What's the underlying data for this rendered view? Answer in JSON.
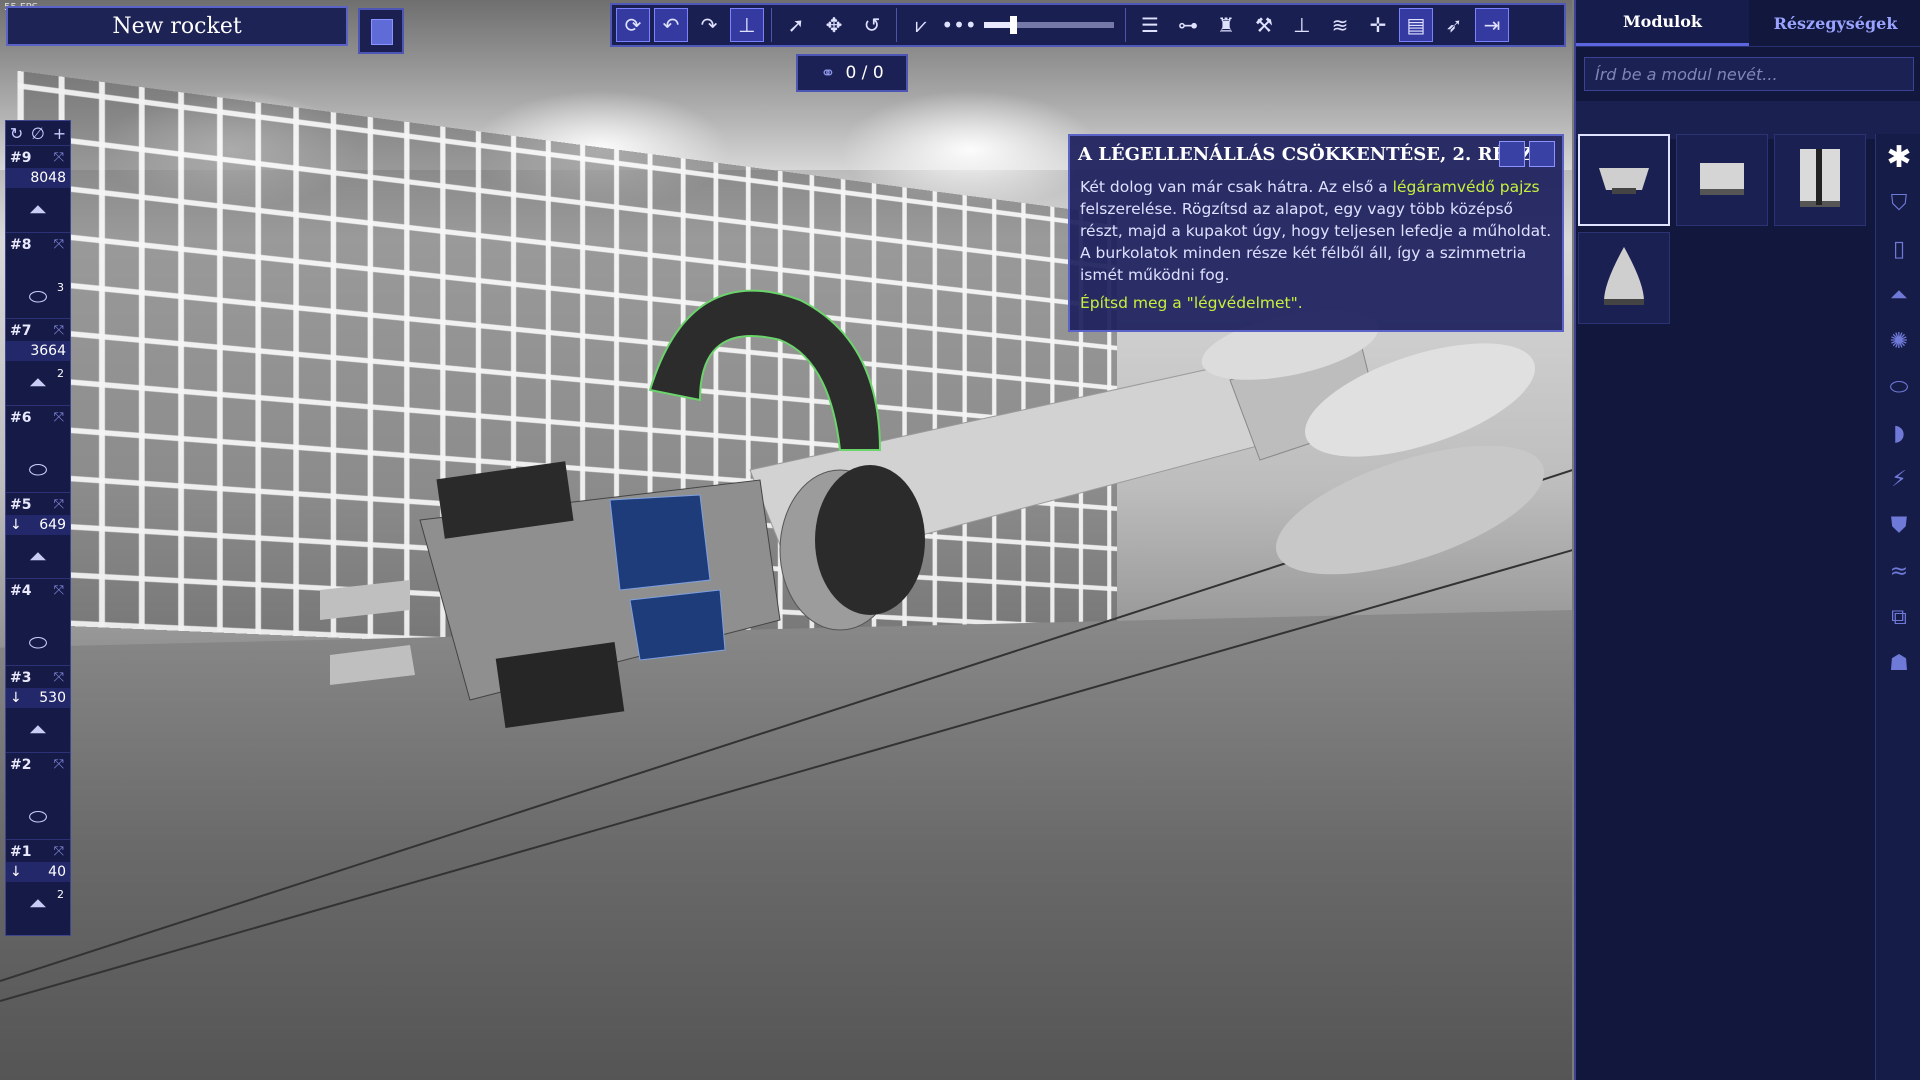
{
  "fps": "55 FPS",
  "rocket_name": "New rocket",
  "counter": {
    "current": "0",
    "sep": "/",
    "total": "0"
  },
  "stages": [
    {
      "num": "#9",
      "value": "8048",
      "arrow": "",
      "icon": "engine-icon",
      "badge": ""
    },
    {
      "num": "#8",
      "value": "",
      "arrow": "",
      "icon": "decoupler-icon",
      "badge": "3"
    },
    {
      "num": "#7",
      "value": "3664",
      "arrow": "",
      "icon": "engine-icon",
      "badge": "2"
    },
    {
      "num": "#6",
      "value": "",
      "arrow": "",
      "icon": "decoupler-icon",
      "badge": ""
    },
    {
      "num": "#5",
      "value": "649",
      "arrow": "↓",
      "icon": "engine-icon",
      "badge": ""
    },
    {
      "num": "#4",
      "value": "",
      "arrow": "",
      "icon": "decoupler-icon",
      "badge": ""
    },
    {
      "num": "#3",
      "value": "530",
      "arrow": "↓",
      "icon": "engine-icon",
      "badge": ""
    },
    {
      "num": "#2",
      "value": "",
      "arrow": "",
      "icon": "decoupler-icon",
      "badge": ""
    },
    {
      "num": "#1",
      "value": "40",
      "arrow": "↓",
      "icon": "engine-icon",
      "badge": "2"
    }
  ],
  "stage_tools": [
    "↻",
    "∅",
    "+"
  ],
  "tutorial": {
    "title": "A LÉGELLENÁLLÁS CSÖKKENTÉSE, 2. RÉSZ",
    "text_1": "Két dolog van már csak hátra. Az első a ",
    "highlight": "légáramvédő pajzs",
    "text_2": " felszerelése. Rögzítsd az alapot, egy vagy több középső részt, majd a kupakot úgy, hogy teljesen lefedje a műholdat. A burkolatok minden része két félből áll, így a szimmetria ismét működni fog.",
    "task": "Építsd meg a \"légvédelmet\"."
  },
  "panel": {
    "tab_modules": "Modulok",
    "tab_subassemblies": "Részegységek",
    "search_placeholder": "Írd be a modul nevét..."
  },
  "toolbar_slider": 0.22,
  "colors": {
    "accent": "#5c66e0",
    "highlight": "#c6f03c",
    "panel": "#11173d"
  }
}
